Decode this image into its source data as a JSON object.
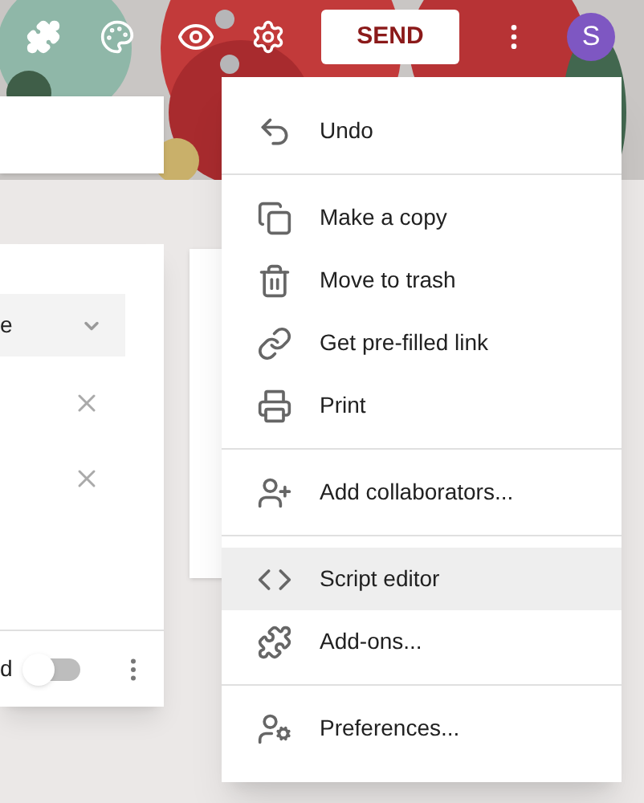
{
  "toolbar": {
    "send_button": "SEND",
    "avatar": "S"
  },
  "form": {
    "dropdown_value": "e",
    "toggle": {
      "label": "d",
      "on": false
    }
  },
  "menu": {
    "sections": [
      [
        {
          "label": "Undo",
          "highlighted": false
        }
      ],
      [
        {
          "label": "Make a copy",
          "highlighted": false
        },
        {
          "label": "Move to trash",
          "highlighted": false
        },
        {
          "label": "Get pre-filled link",
          "highlighted": false
        },
        {
          "label": "Print",
          "highlighted": false
        }
      ],
      [
        {
          "label": "Add collaborators...",
          "highlighted": false
        }
      ],
      [
        {
          "label": "Script editor",
          "highlighted": true
        },
        {
          "label": "Add-ons...",
          "highlighted": false
        }
      ],
      [
        {
          "label": "Preferences...",
          "highlighted": false
        }
      ]
    ]
  }
}
